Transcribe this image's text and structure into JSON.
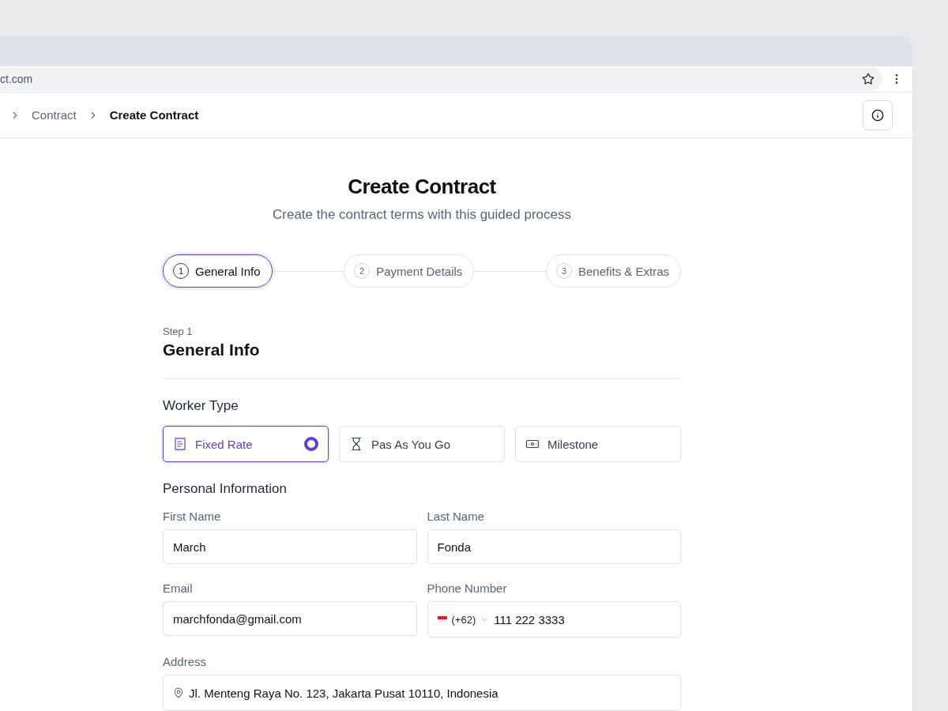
{
  "browser": {
    "url": "ct.com"
  },
  "breadcrumb": [
    {
      "label": "Contract",
      "current": false
    },
    {
      "label": "Create Contract",
      "current": true
    }
  ],
  "header": {
    "title": "Create Contract",
    "subtitle": "Create the contract terms with this guided process"
  },
  "steps": [
    {
      "number": "1",
      "label": "General Info",
      "selected": true
    },
    {
      "number": "2",
      "label": "Payment Details",
      "selected": false
    },
    {
      "number": "3",
      "label": "Benefits & Extras",
      "selected": false
    }
  ],
  "section": {
    "step": "Step 1",
    "title": "General Info"
  },
  "worker_type": {
    "label": "Worker Type",
    "options": [
      {
        "kind": "receipt",
        "label": "Fixed Rate",
        "selected": true
      },
      {
        "kind": "hourglass",
        "label": "Pas As You Go",
        "selected": false
      },
      {
        "kind": "cash",
        "label": "Milestone",
        "selected": false
      }
    ]
  },
  "personal_info": {
    "title": "Personal Information",
    "fields": [
      {
        "label": "First Name",
        "value": "March"
      },
      {
        "label": "Last Name",
        "value": "Fonda"
      },
      {
        "label": "Email",
        "value": "marchfonda@gmail.com"
      },
      {
        "label": "Phone Number",
        "kind": "phone",
        "country_code": "(+62)",
        "value": "111 222 3333"
      }
    ],
    "address": {
      "label": "Address",
      "value": "Jl. Menteng Raya No. 123, Jakarta Pusat 10110, Indonesia"
    }
  }
}
